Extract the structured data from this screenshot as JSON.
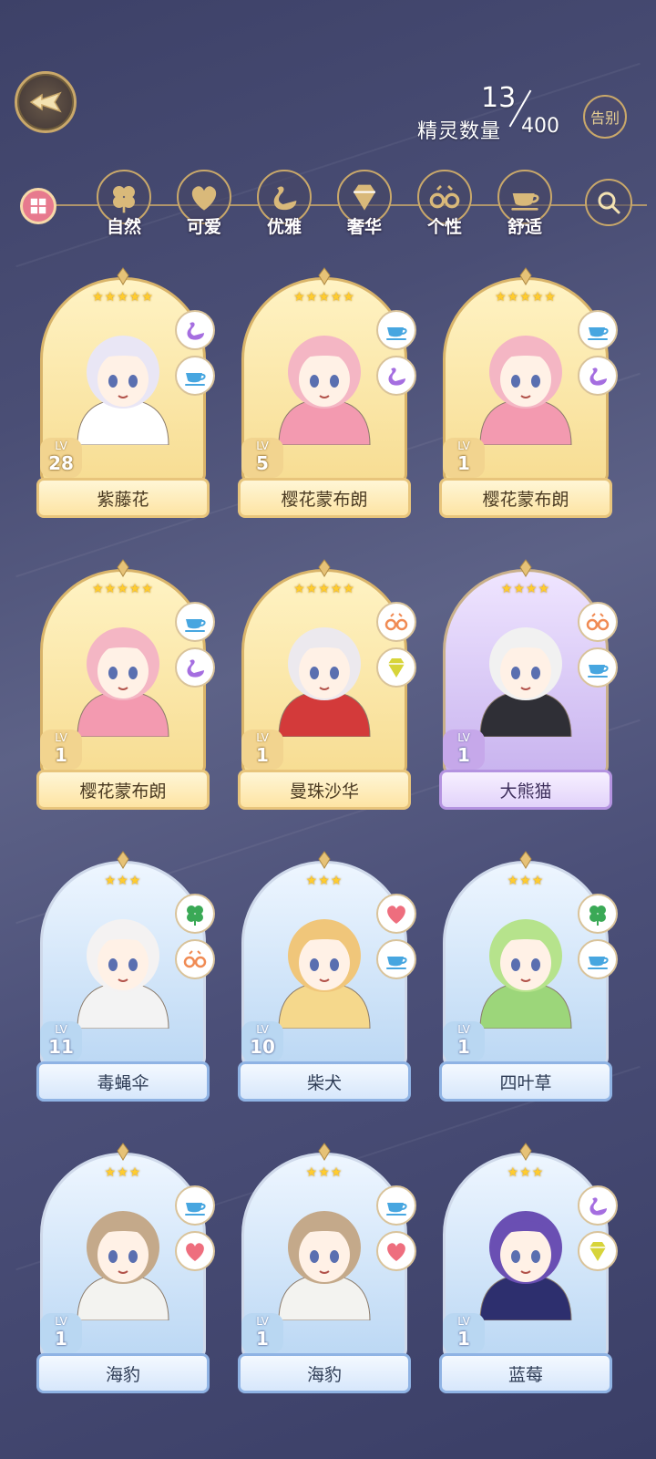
{
  "header": {
    "back_icon": "wing-arrow-icon",
    "spirit_count_label": "精灵数量",
    "spirit_count": "13",
    "spirit_total": "400",
    "farewell_label": "告别"
  },
  "filters": {
    "all_icon": "grid-icon",
    "search_icon": "search-icon",
    "items": [
      {
        "label": "自然",
        "icon": "clover-icon"
      },
      {
        "label": "可爱",
        "icon": "heart-icon"
      },
      {
        "label": "优雅",
        "icon": "swan-icon"
      },
      {
        "label": "奢华",
        "icon": "diamond-icon"
      },
      {
        "label": "个性",
        "icon": "glasses-icon"
      },
      {
        "label": "舒适",
        "icon": "teacup-icon"
      }
    ]
  },
  "colors": {
    "gold_frame": "#f7dd93",
    "purple_frame": "#c9b4ef",
    "blue_frame": "#bcd8f4",
    "star": "#ffcc2e"
  },
  "cards": [
    {
      "name": "紫藤花",
      "lv_label": "LV",
      "level": "28",
      "stars": "★★★★★",
      "tier": "gold",
      "attrs": [
        "swan-icon",
        "teacup-icon"
      ]
    },
    {
      "name": "樱花蒙布朗",
      "lv_label": "LV",
      "level": "5",
      "stars": "★★★★★",
      "tier": "gold",
      "attrs": [
        "teacup-icon",
        "swan-icon"
      ]
    },
    {
      "name": "樱花蒙布朗",
      "lv_label": "LV",
      "level": "1",
      "stars": "★★★★★",
      "tier": "gold",
      "attrs": [
        "teacup-icon",
        "swan-icon"
      ]
    },
    {
      "name": "樱花蒙布朗",
      "lv_label": "LV",
      "level": "1",
      "stars": "★★★★★",
      "tier": "gold",
      "attrs": [
        "teacup-icon",
        "swan-icon"
      ]
    },
    {
      "name": "曼珠沙华",
      "lv_label": "LV",
      "level": "1",
      "stars": "★★★★★",
      "tier": "gold",
      "attrs": [
        "glasses-icon",
        "diamond-icon"
      ]
    },
    {
      "name": "大熊猫",
      "lv_label": "LV",
      "level": "1",
      "stars": "★★★★",
      "tier": "purple",
      "attrs": [
        "glasses-icon",
        "teacup-icon"
      ]
    },
    {
      "name": "毒蝇伞",
      "lv_label": "LV",
      "level": "11",
      "stars": "★★★",
      "tier": "blue",
      "attrs": [
        "clover-icon",
        "glasses-icon"
      ]
    },
    {
      "name": "柴犬",
      "lv_label": "LV",
      "level": "10",
      "stars": "★★★",
      "tier": "blue",
      "attrs": [
        "heart-icon",
        "teacup-icon"
      ]
    },
    {
      "name": "四叶草",
      "lv_label": "LV",
      "level": "1",
      "stars": "★★★",
      "tier": "blue",
      "attrs": [
        "clover-icon",
        "teacup-icon"
      ]
    },
    {
      "name": "海豹",
      "lv_label": "LV",
      "level": "1",
      "stars": "★★★",
      "tier": "blue",
      "attrs": [
        "teacup-icon",
        "heart-icon"
      ]
    },
    {
      "name": "海豹",
      "lv_label": "LV",
      "level": "1",
      "stars": "★★★",
      "tier": "blue",
      "attrs": [
        "teacup-icon",
        "heart-icon"
      ]
    },
    {
      "name": "蓝莓",
      "lv_label": "LV",
      "level": "1",
      "stars": "★★★",
      "tier": "blue",
      "attrs": [
        "swan-icon",
        "diamond-icon"
      ]
    }
  ]
}
